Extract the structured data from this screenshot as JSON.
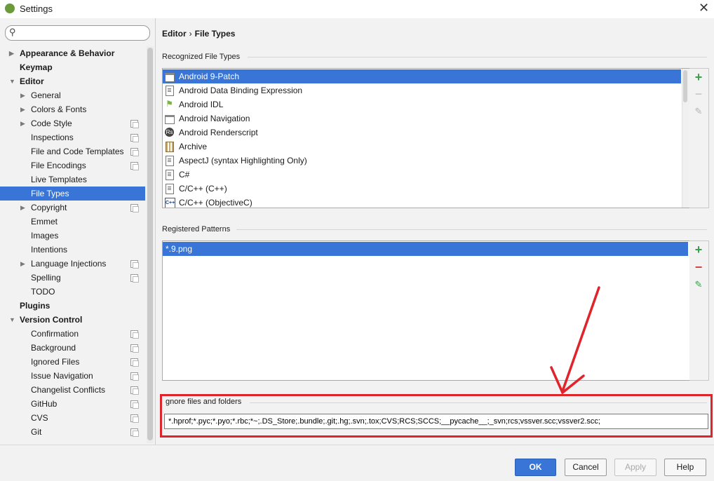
{
  "window": {
    "title": "Settings",
    "close_glyph": "✕"
  },
  "search": {
    "placeholder": "",
    "value": ""
  },
  "sidebar": {
    "items": [
      {
        "label": "Appearance & Behavior",
        "level": 0,
        "bold": true,
        "arrow": "right"
      },
      {
        "label": "Keymap",
        "level": 0,
        "bold": true
      },
      {
        "label": "Editor",
        "level": 0,
        "bold": true,
        "arrow": "down"
      },
      {
        "label": "General",
        "level": 1,
        "arrow": "right"
      },
      {
        "label": "Colors & Fonts",
        "level": 1,
        "arrow": "right"
      },
      {
        "label": "Code Style",
        "level": 1,
        "arrow": "right",
        "copy": true
      },
      {
        "label": "Inspections",
        "level": 1,
        "copy": true
      },
      {
        "label": "File and Code Templates",
        "level": 1,
        "copy": true
      },
      {
        "label": "File Encodings",
        "level": 1,
        "copy": true
      },
      {
        "label": "Live Templates",
        "level": 1
      },
      {
        "label": "File Types",
        "level": 1,
        "selected": true
      },
      {
        "label": "Copyright",
        "level": 1,
        "arrow": "right",
        "copy": true
      },
      {
        "label": "Emmet",
        "level": 1
      },
      {
        "label": "Images",
        "level": 1
      },
      {
        "label": "Intentions",
        "level": 1
      },
      {
        "label": "Language Injections",
        "level": 1,
        "arrow": "right",
        "copy": true
      },
      {
        "label": "Spelling",
        "level": 1,
        "copy": true
      },
      {
        "label": "TODO",
        "level": 1
      },
      {
        "label": "Plugins",
        "level": 0,
        "bold": true
      },
      {
        "label": "Version Control",
        "level": 0,
        "bold": true,
        "arrow": "down"
      },
      {
        "label": "Confirmation",
        "level": 1,
        "copy": true
      },
      {
        "label": "Background",
        "level": 1,
        "copy": true
      },
      {
        "label": "Ignored Files",
        "level": 1,
        "copy": true
      },
      {
        "label": "Issue Navigation",
        "level": 1,
        "copy": true
      },
      {
        "label": "Changelist Conflicts",
        "level": 1,
        "copy": true
      },
      {
        "label": "GitHub",
        "level": 1,
        "copy": true
      },
      {
        "label": "CVS",
        "level": 1,
        "copy": true
      },
      {
        "label": "Git",
        "level": 1,
        "copy": true
      }
    ]
  },
  "breadcrumb": {
    "parent": "Editor",
    "separator": "›",
    "current": "File Types"
  },
  "recognized": {
    "title": "Recognized File Types",
    "items": [
      {
        "label": "Android 9-Patch",
        "icon": "folder-icon",
        "selected": true
      },
      {
        "label": "Android Data Binding Expression",
        "icon": "document-icon"
      },
      {
        "label": "Android IDL",
        "icon": "android-icon"
      },
      {
        "label": "Android Navigation",
        "icon": "folder-icon"
      },
      {
        "label": "Android Renderscript",
        "icon": "renderscript-icon"
      },
      {
        "label": "Archive",
        "icon": "archive-icon"
      },
      {
        "label": "AspectJ (syntax Highlighting Only)",
        "icon": "document-icon"
      },
      {
        "label": "C#",
        "icon": "document-icon"
      },
      {
        "label": "C/C++ (C++)",
        "icon": "document-icon"
      },
      {
        "label": "C/C++ (ObjectiveC)",
        "icon": "cpp-icon"
      }
    ]
  },
  "patterns": {
    "title": "Registered Patterns",
    "items": [
      {
        "label": "*.9.png",
        "selected": true
      }
    ]
  },
  "ignore": {
    "label": "gnore files and folders",
    "value": "*.hprof;*.pyc;*.pyo;*.rbc;*~;.DS_Store;.bundle;.git;.hg;.svn;.tox;CVS;RCS;SCCS;__pycache__;_svn;rcs;vssver.scc;vssver2.scc;"
  },
  "buttons": {
    "ok": "OK",
    "cancel": "Cancel",
    "apply": "Apply",
    "help": "Help"
  },
  "colors": {
    "selection": "#3875d7",
    "highlight_box": "#e0242c",
    "annotation_arrow": "#e0242c"
  }
}
